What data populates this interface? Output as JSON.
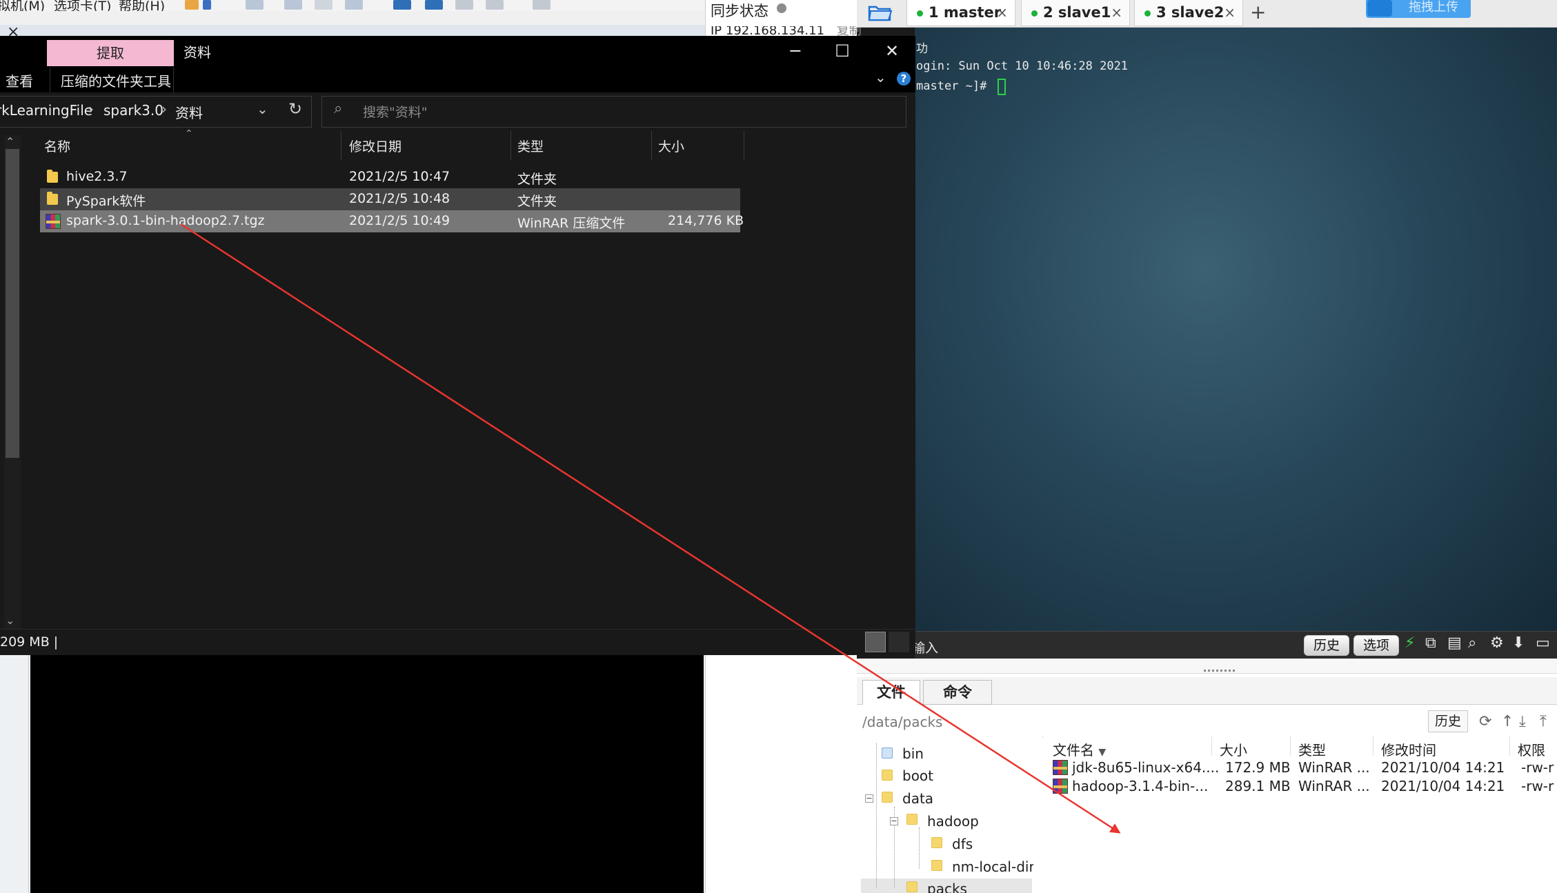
{
  "vm": {
    "menu": [
      "拟机(M)",
      "选项卡(T)",
      "帮助(H)"
    ],
    "close_glyph": "×"
  },
  "sync": {
    "title": "同步状态",
    "ip": "IP 192.168.134.11",
    "copy": "复制"
  },
  "terminal": {
    "tabs": [
      {
        "label": "1 master",
        "active": true
      },
      {
        "label": "2 slave1",
        "active": false
      },
      {
        "label": "3 slave2",
        "active": false
      }
    ],
    "add_tab": "+",
    "upload_label": "拖拽上传",
    "lines": [
      "功",
      "ogin: Sun Oct 10 10:46:28 2021",
      "master ~]# "
    ],
    "input_label": "输入",
    "history_btn": "历史",
    "options_btn": "选项"
  },
  "sftp": {
    "tab_file": "文件",
    "tab_command": "命令",
    "path": "/data/packs",
    "history_btn": "历史",
    "tree": [
      {
        "name": "bin",
        "indent": 0,
        "expander": ""
      },
      {
        "name": "boot",
        "indent": 0,
        "expander": ""
      },
      {
        "name": "data",
        "indent": 0,
        "expander": "−"
      },
      {
        "name": "hadoop",
        "indent": 1,
        "expander": "−"
      },
      {
        "name": "dfs",
        "indent": 2,
        "expander": ""
      },
      {
        "name": "nm-local-dir",
        "indent": 2,
        "expander": ""
      },
      {
        "name": "packs",
        "indent": 1,
        "expander": ""
      }
    ],
    "columns": [
      "文件名",
      "大小",
      "类型",
      "修改时间",
      "权限"
    ],
    "files": [
      {
        "name": "jdk-8u65-linux-x64....",
        "size": "172.9 MB",
        "type": "WinRAR ...",
        "mtime": "2021/10/04 14:21",
        "perm": "-rw-r"
      },
      {
        "name": "hadoop-3.1.4-bin-...",
        "size": "289.1 MB",
        "type": "WinRAR ...",
        "mtime": "2021/10/04 14:21",
        "perm": "-rw-r"
      }
    ]
  },
  "explorer": {
    "extract_tab": "提取",
    "title": "资料",
    "view_tab": "查看",
    "tools_tab": "压缩的文件夹工具",
    "breadcrumb": [
      "rkLearningFile",
      "spark3.0",
      "资料"
    ],
    "search_placeholder": "搜索\"资料\"",
    "columns": [
      "名称",
      "修改日期",
      "类型",
      "大小"
    ],
    "rows": [
      {
        "name": "hive2.3.7",
        "date": "2021/2/5 10:47",
        "type": "文件夹",
        "size": "",
        "icon": "folder-icon",
        "state": "normal"
      },
      {
        "name": "PySpark软件",
        "date": "2021/2/5 10:48",
        "type": "文件夹",
        "size": "",
        "icon": "folder-icon",
        "state": "hover"
      },
      {
        "name": "spark-3.0.1-bin-hadoop2.7.tgz",
        "date": "2021/2/5 10:49",
        "type": "WinRAR 压缩文件",
        "size": "214,776 KB",
        "icon": "winrar-archive-icon",
        "state": "selected"
      }
    ],
    "status": "209 MB  |"
  },
  "colors": {
    "drag_arrow": "#e8352f",
    "extract_tab_bg": "#f4b8d2",
    "tab_dot": "#19b23a"
  }
}
